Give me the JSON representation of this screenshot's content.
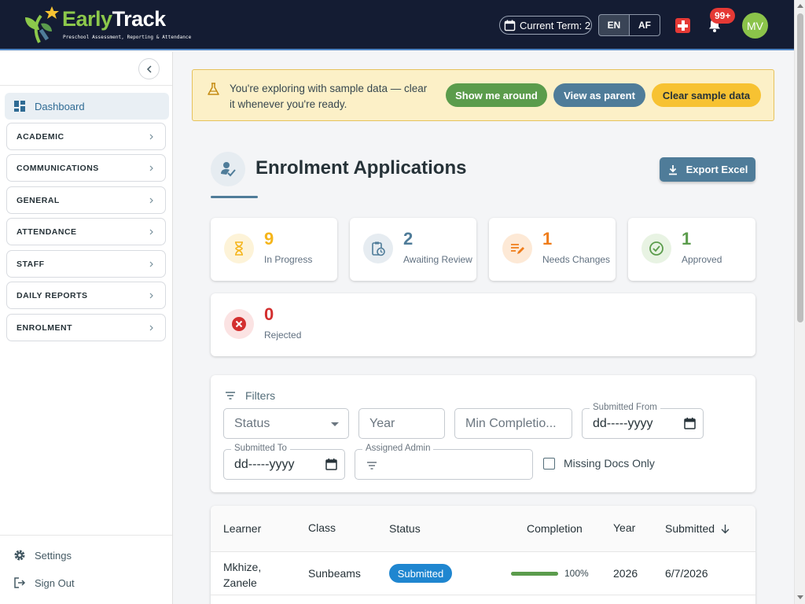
{
  "app": {
    "name_part1": "Early",
    "name_part2": "Track",
    "tagline": "Preschool Assessment, Reporting & Attendance"
  },
  "header": {
    "term_label": "Current Term: 2",
    "lang_en": "EN",
    "lang_af": "AF",
    "notification_count": "99+",
    "avatar_initials": "MV"
  },
  "sidebar": {
    "dashboard": "Dashboard",
    "items": [
      {
        "label": "ACADEMIC"
      },
      {
        "label": "COMMUNICATIONS"
      },
      {
        "label": "GENERAL"
      },
      {
        "label": "ATTENDANCE"
      },
      {
        "label": "STAFF"
      },
      {
        "label": "DAILY REPORTS"
      },
      {
        "label": "ENROLMENT"
      }
    ],
    "settings": "Settings",
    "signout": "Sign Out"
  },
  "banner": {
    "message": "You're exploring with sample data — clear it whenever you're ready.",
    "show_me_around": "Show me around",
    "view_as_parent": "View as parent",
    "clear_sample": "Clear sample data"
  },
  "page": {
    "title": "Enrolment Applications",
    "export_label": "Export Excel"
  },
  "stats": [
    {
      "value": "9",
      "label": "In Progress",
      "color": "#f5b51b"
    },
    {
      "value": "2",
      "label": "Awaiting Review",
      "color": "#4f7c99"
    },
    {
      "value": "1",
      "label": "Needs Changes",
      "color": "#ef7c1a"
    },
    {
      "value": "1",
      "label": "Approved",
      "color": "#5b9c4c"
    },
    {
      "value": "0",
      "label": "Rejected",
      "color": "#d32f2f"
    }
  ],
  "filters": {
    "heading": "Filters",
    "status_placeholder": "Status",
    "year_placeholder": "Year",
    "min_completion_placeholder": "Min Completio...",
    "submitted_from_label": "Submitted From",
    "submitted_from_value": "dd-----yyyy",
    "submitted_to_label": "Submitted To",
    "submitted_to_value": "dd-----yyyy",
    "assigned_admin_label": "Assigned Admin",
    "missing_docs_label": "Missing Docs Only"
  },
  "table": {
    "headers": {
      "learner": "Learner",
      "class": "Class",
      "status": "Status",
      "completion": "Completion",
      "year": "Year",
      "submitted": "Submitted"
    },
    "rows": [
      {
        "learner_line1": "Mkhize,",
        "learner_line2": "Zanele",
        "class": "Sunbeams",
        "status": "Submitted",
        "completion": 1.0,
        "completion_label": "100%",
        "year": "2026",
        "submitted": "6/7/2026"
      }
    ]
  }
}
